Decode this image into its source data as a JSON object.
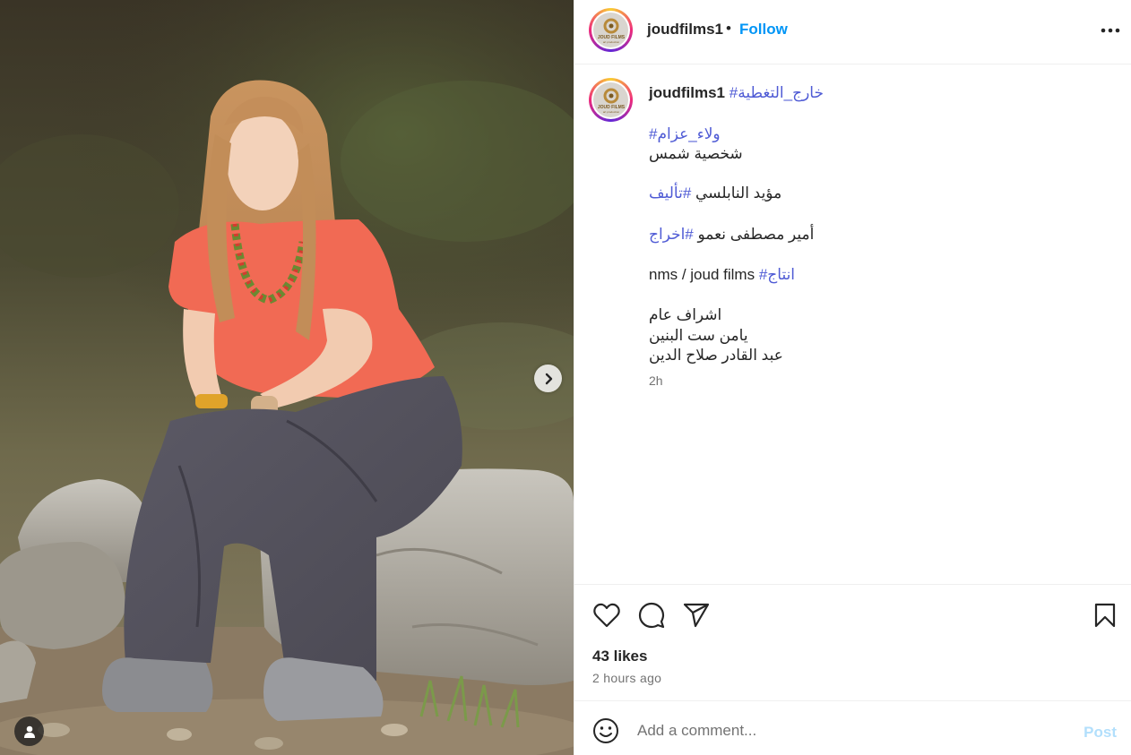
{
  "header": {
    "username": "joudfilms1",
    "separator": "•",
    "follow_label": "Follow"
  },
  "logo": {
    "brand": "JOUD FILMS",
    "sub": "art production"
  },
  "caption": {
    "username": "joudfilms1",
    "lines": [
      {
        "tag": "#خارج_التغطية",
        "text": ""
      },
      {
        "tag": "#ولاء_عزام",
        "text": ""
      },
      {
        "tag": "",
        "text": "شخصية شمس"
      },
      {
        "tag": "#تأليف",
        "text": "مؤيد النابلسي"
      },
      {
        "tag": "#اخراج",
        "text": "أمير مصطفى نعمو"
      },
      {
        "tag": "#انتاج",
        "text": "nms / joud films"
      },
      {
        "tag": "",
        "text": "اشراف عام"
      },
      {
        "tag": "",
        "text": "يامن ست البنين"
      },
      {
        "tag": "",
        "text": "عبد القادر صلاح الدين"
      }
    ],
    "time": "2h"
  },
  "engagement": {
    "likes": "43 likes",
    "posted": "2 hours ago"
  },
  "comment": {
    "placeholder": "Add a comment...",
    "post_label": "Post"
  },
  "icons": {
    "more": "more-options-icon",
    "like": "heart-icon",
    "comment": "comment-bubble-icon",
    "share": "paper-plane-icon",
    "save": "bookmark-icon",
    "emoji": "emoji-icon",
    "next": "chevron-right-icon",
    "tags": "user-tag-icon"
  },
  "colors": {
    "link": "#0095f6",
    "hashtag": "#4f5bd5",
    "post_disabled": "#b2dffc",
    "muted": "#737373"
  }
}
